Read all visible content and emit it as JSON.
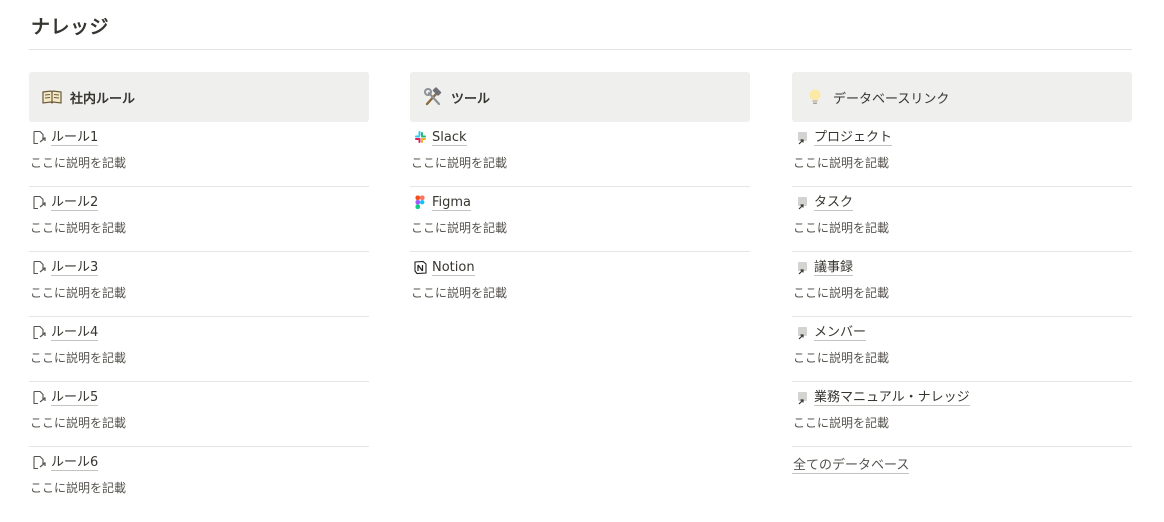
{
  "page": {
    "title": "ナレッジ"
  },
  "columns": [
    {
      "title": "社内ルール",
      "icon": "open-book-icon",
      "items": [
        {
          "label": "ルール1",
          "desc": "ここに説明を記載",
          "icon": "page-link-icon"
        },
        {
          "label": "ルール2",
          "desc": "ここに説明を記載",
          "icon": "page-link-icon"
        },
        {
          "label": "ルール3",
          "desc": "ここに説明を記載",
          "icon": "page-link-icon"
        },
        {
          "label": "ルール4",
          "desc": "ここに説明を記載",
          "icon": "page-link-icon"
        },
        {
          "label": "ルール5",
          "desc": "ここに説明を記載",
          "icon": "page-link-icon"
        },
        {
          "label": "ルール6",
          "desc": "ここに説明を記載",
          "icon": "page-link-icon"
        }
      ]
    },
    {
      "title": "ツール",
      "icon": "hammer-wrench-icon",
      "items": [
        {
          "label": "Slack",
          "desc": "ここに説明を記載",
          "icon": "slack-icon"
        },
        {
          "label": "Figma",
          "desc": "ここに説明を記載",
          "icon": "figma-icon"
        },
        {
          "label": "Notion",
          "desc": "ここに説明を記載",
          "icon": "notion-icon"
        }
      ]
    },
    {
      "title": "データベースリンク",
      "icon": "light-bulb-icon",
      "items": [
        {
          "label": "プロジェクト",
          "desc": "ここに説明を記載",
          "icon": "database-link-icon"
        },
        {
          "label": "タスク",
          "desc": "ここに説明を記載",
          "icon": "database-link-icon"
        },
        {
          "label": "議事録",
          "desc": "ここに説明を記載",
          "icon": "database-link-icon"
        },
        {
          "label": "メンバー",
          "desc": "ここに説明を記載",
          "icon": "database-link-icon"
        },
        {
          "label": "業務マニュアル・ナレッジ",
          "desc": "ここに説明を記載",
          "icon": "database-link-icon"
        }
      ],
      "footer_link": "全てのデータベース"
    }
  ]
}
